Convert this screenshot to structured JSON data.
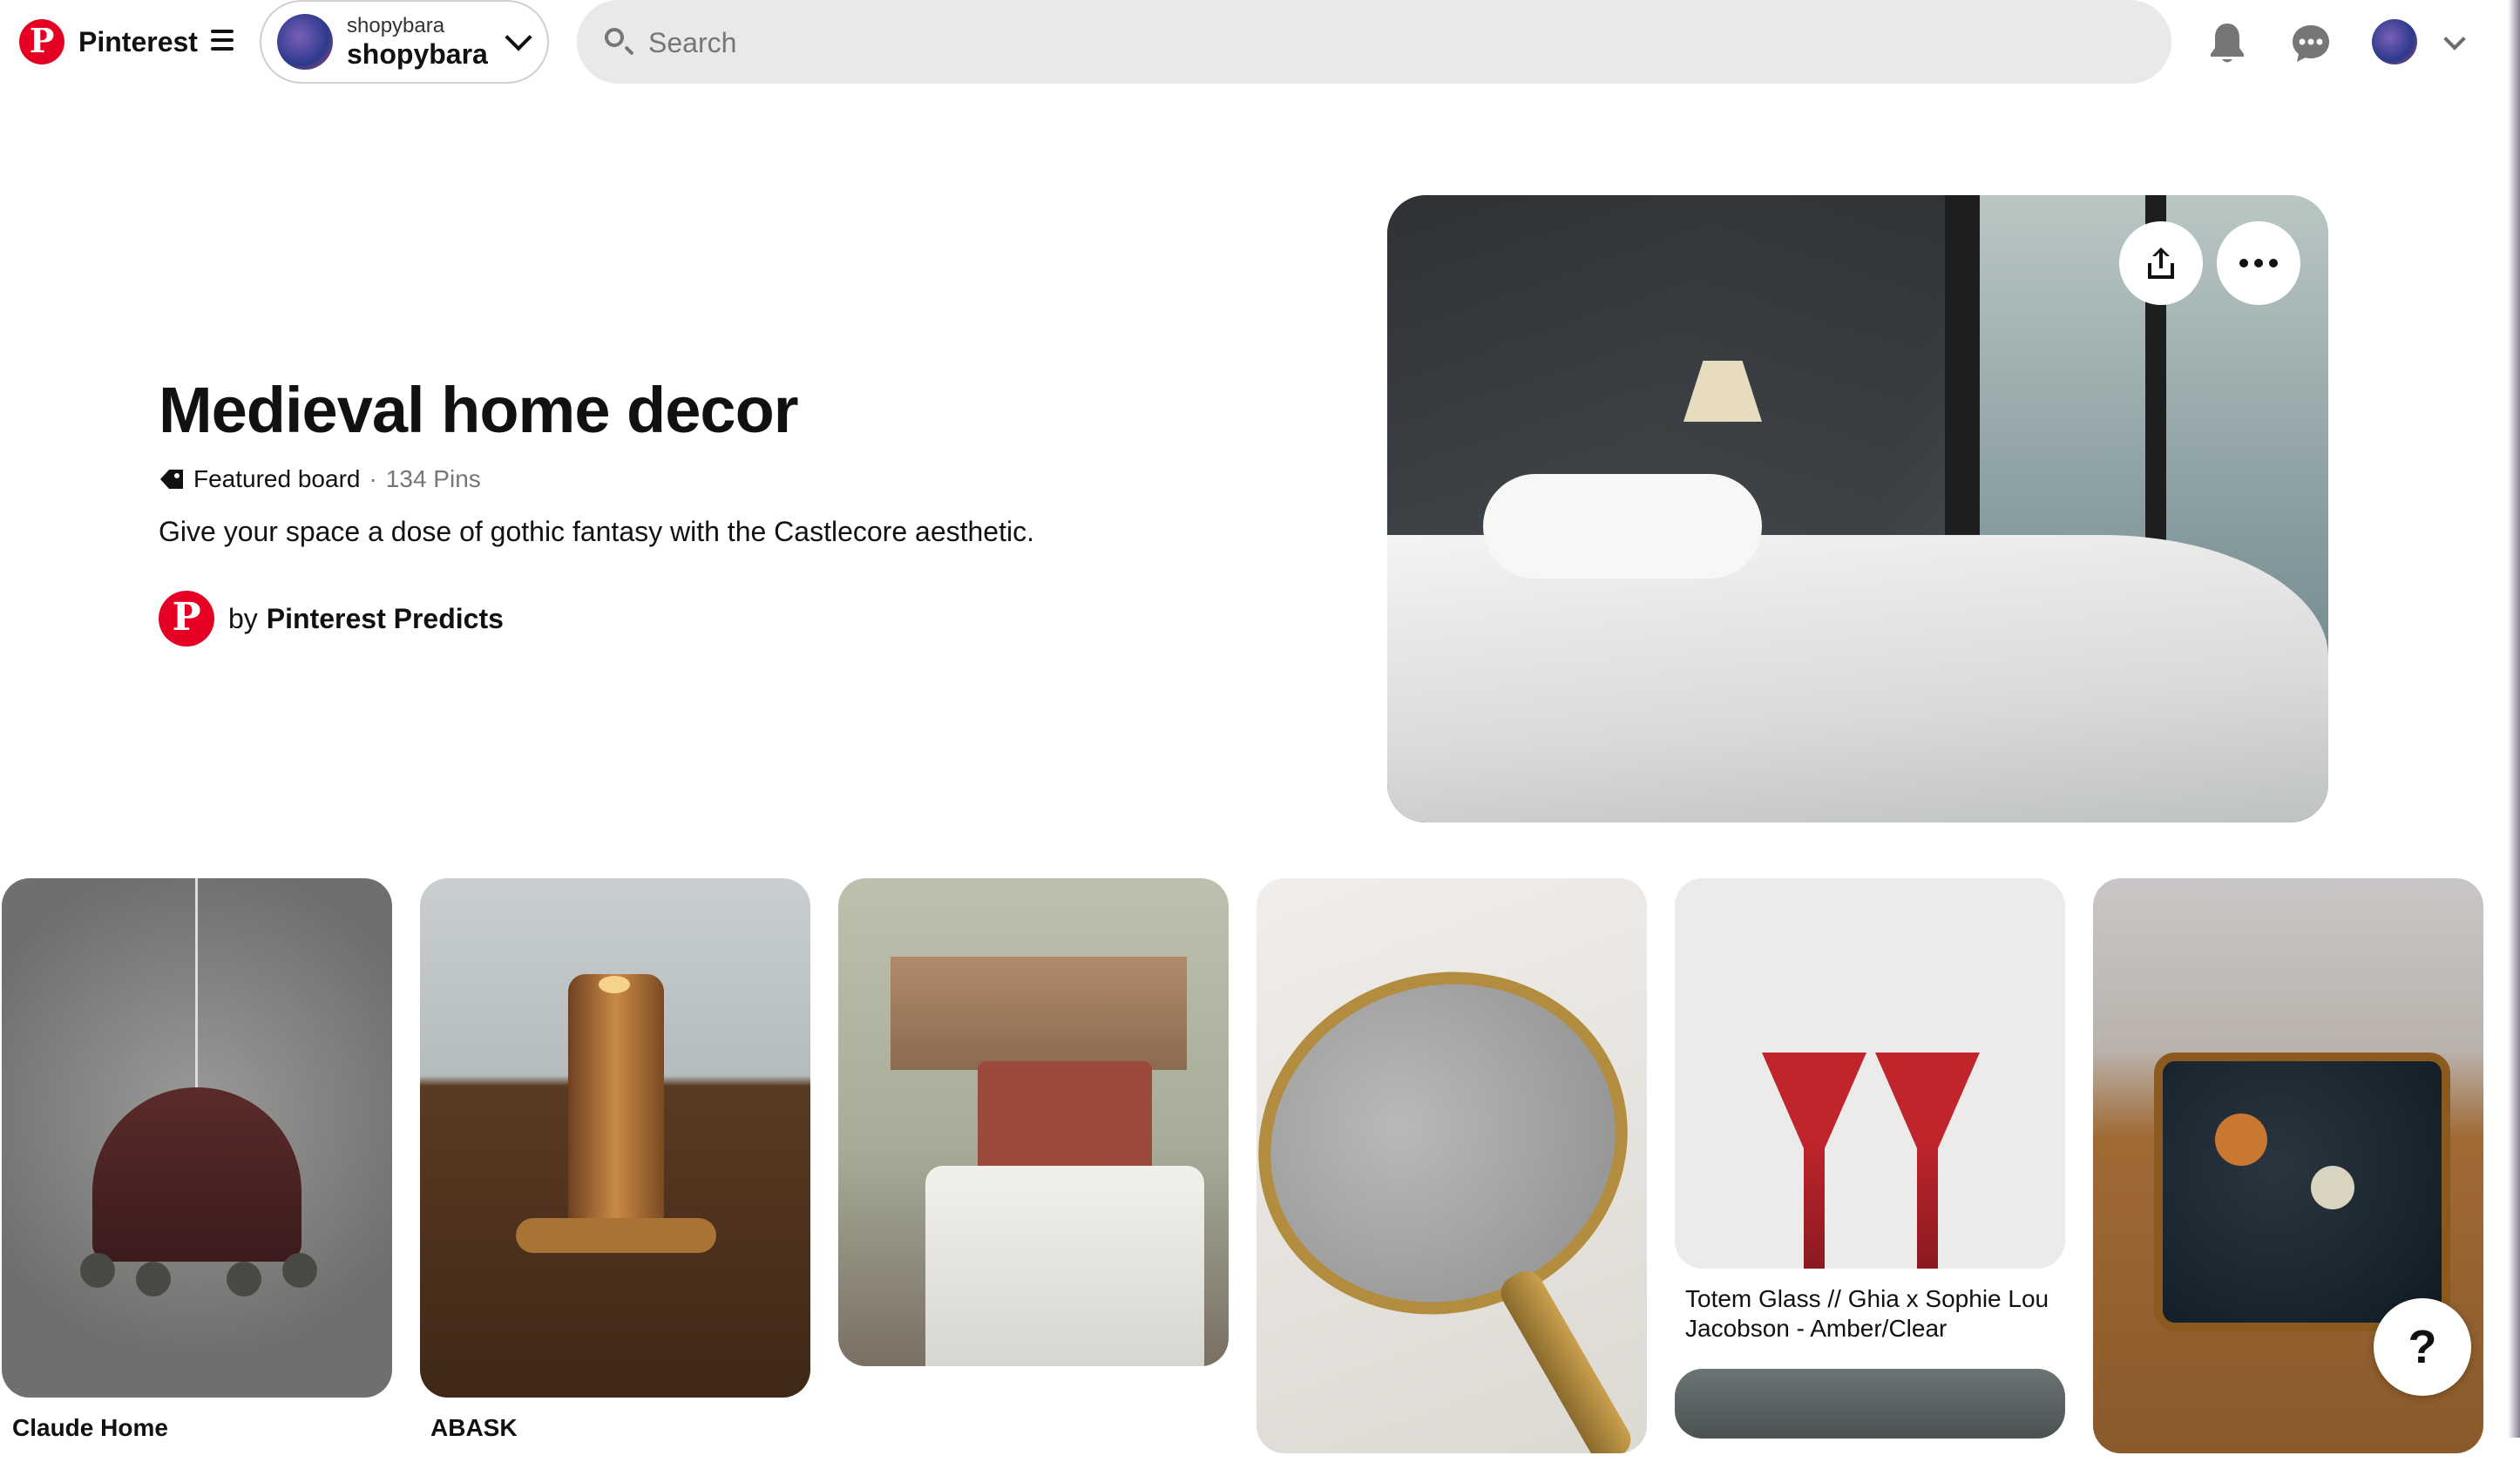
{
  "app": {
    "name": "Pinterest"
  },
  "header": {
    "account": {
      "small_name": "shopybara",
      "big_name": "shopybara"
    },
    "search": {
      "placeholder": "Search",
      "value": ""
    }
  },
  "board": {
    "title": "Medieval home decor",
    "featured_label": "Featured board",
    "separator": "·",
    "pin_count": "134 Pins",
    "description": "Give your space a dose of gothic fantasy with the Castlecore aesthetic.",
    "creator_prefix": "by",
    "creator_name": "Pinterest Predicts"
  },
  "pins": [
    {
      "caption": "Claude Home",
      "bold": true
    },
    {
      "caption": "ABASK",
      "bold": true
    },
    {
      "caption": "",
      "bold": false
    },
    {
      "caption": "",
      "bold": false
    },
    {
      "caption": "Totem Glass // Ghia x Sophie Lou Jacobson - Amber/Clear",
      "bold": false
    },
    {
      "caption": "",
      "bold": false
    }
  ],
  "help": {
    "label": "?"
  },
  "icons": {
    "logo": "pinterest-logo",
    "menu": "menu-icon",
    "bell": "bell-icon",
    "chat": "chat-icon",
    "share": "share-icon",
    "more": "more-icon",
    "tag": "tag-icon"
  },
  "colors": {
    "brand": "#e60023",
    "search_bg": "#e9e9e9",
    "muted_text": "#767676"
  }
}
